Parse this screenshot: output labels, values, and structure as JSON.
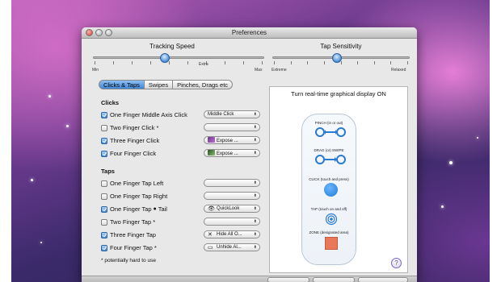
{
  "window": {
    "title": "Preferences"
  },
  "tracking": {
    "title": "Tracking Speed",
    "min_label": "Min",
    "max_label": "Max",
    "extra_label": "Extra",
    "value_fraction": 0.42
  },
  "tap_sensitivity": {
    "title": "Tap Sensitivity",
    "left_label": "Extreme",
    "right_label": "Relaxed",
    "value_fraction": 0.47
  },
  "tabs": [
    {
      "label": "Clicks & Taps",
      "active": true
    },
    {
      "label": "Swipes",
      "active": false
    },
    {
      "label": "Pinches, Drags etc",
      "active": false
    }
  ],
  "clicks": {
    "title": "Clicks",
    "rows": [
      {
        "label": "One Finger Middle Axis Click",
        "checked": true,
        "popup": "Middle Click"
      },
      {
        "label": "Two Finger Click *",
        "checked": false,
        "popup": ""
      },
      {
        "label": "Three Finger Click",
        "checked": true,
        "popup": "Expose ..."
      },
      {
        "label": "Four Finger Click",
        "checked": true,
        "popup": "Expose ..."
      }
    ]
  },
  "taps": {
    "title": "Taps",
    "rows": [
      {
        "label": "One Finger Tap Left",
        "checked": false,
        "popup": ""
      },
      {
        "label": "One Finger Tap Right",
        "checked": false,
        "popup": ""
      },
      {
        "label": "One Finger Tap",
        "suffix": "Tail",
        "checked": true,
        "popup": "QuickLook"
      },
      {
        "label": "Two Finger Tap *",
        "checked": false,
        "popup": ""
      },
      {
        "label": "Three Finger Tap",
        "checked": true,
        "popup": "Hide All O..."
      },
      {
        "label": "Four Finger Tap *",
        "checked": true,
        "popup": "Unhide Al..."
      }
    ]
  },
  "footnote": "* potentially hard to use",
  "display_panel": {
    "title": "Turn real-time graphical display ON",
    "gestures": [
      {
        "label": "PINCH (in or out)"
      },
      {
        "label": "DRAG (or) SWIPE"
      },
      {
        "label": "CLICK (touch and press)"
      },
      {
        "label": "TAP (touch on and off)"
      },
      {
        "label": "ZONE (designated area)"
      }
    ],
    "help_label": "?"
  },
  "colors": {
    "accent": "#3f86d6",
    "click_dot": "#1f7ed6",
    "zone": "#e9775a"
  }
}
